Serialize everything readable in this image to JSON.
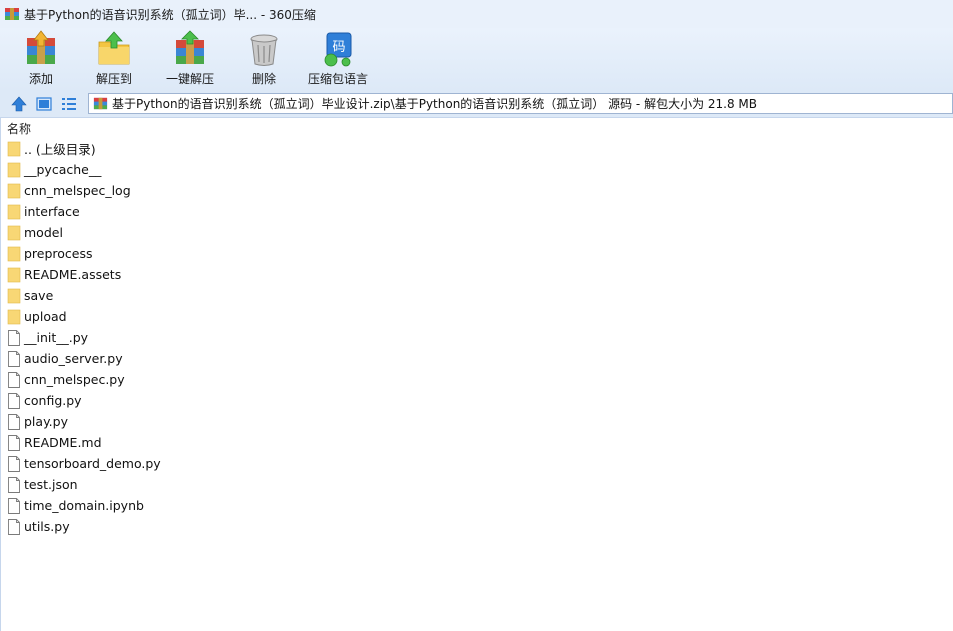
{
  "window": {
    "title": "基于Python的语音识别系统（孤立词）毕... - 360压缩"
  },
  "toolbar": {
    "buttons": [
      {
        "label": "添加",
        "icon": "add-archive-icon"
      },
      {
        "label": "解压到",
        "icon": "extract-to-icon"
      },
      {
        "label": "一键解压",
        "icon": "one-click-extract-icon"
      },
      {
        "label": "删除",
        "icon": "delete-trash-icon"
      },
      {
        "label": "压缩包语言",
        "icon": "archive-encoding-icon"
      }
    ]
  },
  "addressbar": {
    "path": "基于Python的语音识别系统（孤立词）毕业设计.zip\\基于Python的语音识别系统（孤立词） 源码 - 解包大小为 21.8 MB"
  },
  "filelist": {
    "column_name": "名称",
    "items": [
      {
        "name": ".. (上级目录)",
        "type": "folder"
      },
      {
        "name": "__pycache__",
        "type": "folder"
      },
      {
        "name": "cnn_melspec_log",
        "type": "folder"
      },
      {
        "name": "interface",
        "type": "folder"
      },
      {
        "name": "model",
        "type": "folder"
      },
      {
        "name": "preprocess",
        "type": "folder"
      },
      {
        "name": "README.assets",
        "type": "folder"
      },
      {
        "name": "save",
        "type": "folder"
      },
      {
        "name": "upload",
        "type": "folder"
      },
      {
        "name": "__init__.py",
        "type": "file"
      },
      {
        "name": "audio_server.py",
        "type": "file"
      },
      {
        "name": "cnn_melspec.py",
        "type": "file"
      },
      {
        "name": "config.py",
        "type": "file"
      },
      {
        "name": "play.py",
        "type": "file"
      },
      {
        "name": "README.md",
        "type": "file"
      },
      {
        "name": "tensorboard_demo.py",
        "type": "file"
      },
      {
        "name": "test.json",
        "type": "file"
      },
      {
        "name": "time_domain.ipynb",
        "type": "file"
      },
      {
        "name": "utils.py",
        "type": "file"
      }
    ]
  },
  "colors": {
    "titlebar_bg": "#e9f1fb",
    "toolbar_bg": "#dde9f7",
    "folder_yellow": "#f8d775",
    "nav_blue": "#2f7fd8"
  }
}
